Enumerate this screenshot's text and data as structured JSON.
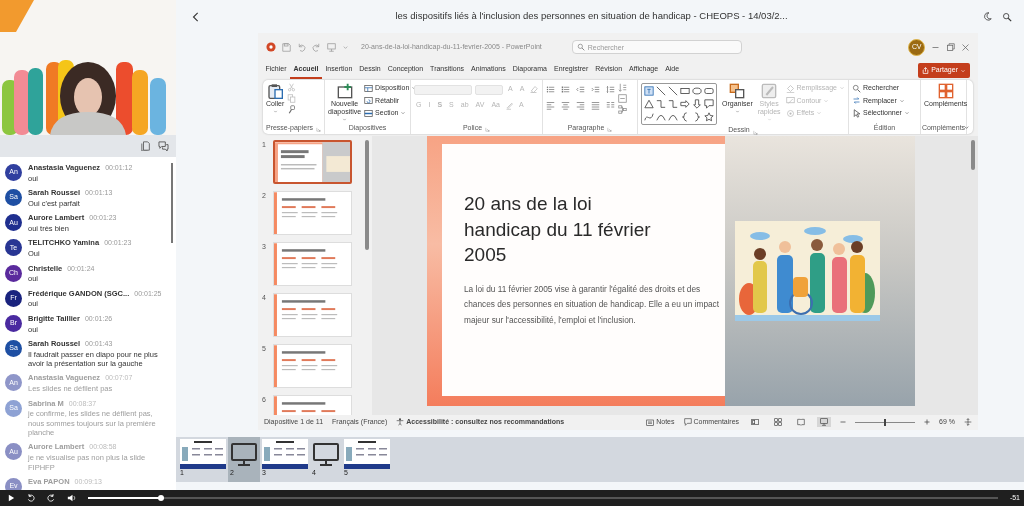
{
  "header": {
    "title": "les dispositifs liés à l'inclusion des personnes en situation de handicap - CHEOPS - 14/03/2..."
  },
  "chat": {
    "messages": [
      {
        "initials": "An",
        "color": "#303f9f",
        "sender": "Anastasia Vaguenez",
        "time": "00:01:12",
        "text": "oui",
        "faded": false
      },
      {
        "initials": "Sa",
        "color": "#1e4fa3",
        "sender": "Sarah Roussel",
        "time": "00:01:13",
        "text": "Oui c'est parfait",
        "faded": false
      },
      {
        "initials": "Au",
        "color": "#1f2f8f",
        "sender": "Aurore Lambert",
        "time": "00:01:23",
        "text": "oui très bien",
        "faded": false
      },
      {
        "initials": "Te",
        "color": "#283593",
        "sender": "TELITCHKO Yamina",
        "time": "00:01:23",
        "text": "Oui",
        "faded": false
      },
      {
        "initials": "Ch",
        "color": "#5a2a9d",
        "sender": "Christelle",
        "time": "00:01:24",
        "text": "oui",
        "faded": false
      },
      {
        "initials": "Fr",
        "color": "#1a237e",
        "sender": "Frédérique GANDON (SGC...",
        "time": "00:01:25",
        "text": "oui",
        "faded": false
      },
      {
        "initials": "Br",
        "color": "#4a2aa0",
        "sender": "Brigitte Taillier",
        "time": "00:01:26",
        "text": "oui",
        "faded": false
      },
      {
        "initials": "Sa",
        "color": "#1e4fa3",
        "sender": "Sarah Roussel",
        "time": "00:01:43",
        "text": "Il faudrait passer en diapo pour ne plus avoir la présentation sur la gauche",
        "faded": false
      },
      {
        "initials": "An",
        "color": "#8f96c9",
        "sender": "Anastasia Vaguenez",
        "time": "00:07:07",
        "text": "Les slides ne défilent pas",
        "faded": true
      },
      {
        "initials": "Sa",
        "color": "#8ea2d4",
        "sender": "Sabrina M",
        "time": "00:08:37",
        "text": "je confirme, les slides ne défilent pas, nous sommes toujours sur la première planche",
        "faded": true
      },
      {
        "initials": "Au",
        "color": "#8a8fc4",
        "sender": "Aurore Lambert",
        "time": "00:08:58",
        "text": "je ne visualise pas non plus la slide FIPHFP",
        "faded": true
      },
      {
        "initials": "Ev",
        "color": "#8a8fc4",
        "sender": "Eva PAPON",
        "time": "00:09:13",
        "faded": true
      }
    ]
  },
  "ppt": {
    "file_title": "20-ans-de-la-loi-handicap-du-11-fevrier-2005 - PowerPoint",
    "search": {
      "placeholder": "Rechercher"
    },
    "user_initials": "CV",
    "tabs": [
      {
        "label": "Fichier",
        "selected": false
      },
      {
        "label": "Accueil",
        "selected": true
      },
      {
        "label": "Insertion",
        "selected": false
      },
      {
        "label": "Dessin",
        "selected": false
      },
      {
        "label": "Conception",
        "selected": false
      },
      {
        "label": "Transitions",
        "selected": false
      },
      {
        "label": "Animations",
        "selected": false
      },
      {
        "label": "Diaporama",
        "selected": false
      },
      {
        "label": "Enregistrer",
        "selected": false
      },
      {
        "label": "Révision",
        "selected": false
      },
      {
        "label": "Affichage",
        "selected": false
      },
      {
        "label": "Aide",
        "selected": false
      }
    ],
    "share_button": "Partager",
    "ribbon": [
      {
        "kind": "clipboard",
        "label": "Presse-papiers",
        "launcher": true,
        "items": [
          {
            "kind": "large",
            "label": "Coller",
            "dropdown": true,
            "disabled": false
          },
          {
            "kind": "icon",
            "disabled": true
          },
          {
            "kind": "icon",
            "disabled": true
          },
          {
            "kind": "icon",
            "disabled": false
          }
        ]
      },
      {
        "kind": "slides",
        "label": "Diapositives",
        "launcher": false,
        "items": [
          {
            "kind": "large",
            "label": "Nouvelle diapositive",
            "dropdown": true,
            "disabled": false
          },
          {
            "kind": "small",
            "label": "Disposition",
            "dropdown": true,
            "disabled": false
          },
          {
            "kind": "small",
            "label": "Rétablir",
            "dropdown": false,
            "disabled": false
          },
          {
            "kind": "small",
            "label": "Section",
            "dropdown": true,
            "disabled": false
          }
        ]
      },
      {
        "kind": "font",
        "label": "Police",
        "launcher": true,
        "first_row": [
          {
            "kind": "field",
            "disabled": true
          },
          {
            "kind": "field",
            "disabled": true
          },
          {
            "kind": "glyph",
            "label": "A",
            "disabled": true
          },
          {
            "kind": "glyph",
            "label": "A",
            "disabled": true
          },
          {
            "kind": "icon",
            "disabled": true
          }
        ],
        "second_row": [
          {
            "kind": "glyph",
            "label": "G",
            "disabled": true
          },
          {
            "kind": "glyph",
            "label": "I",
            "disabled": true
          },
          {
            "kind": "glyph",
            "label": "S",
            "disabled": true
          },
          {
            "kind": "glyph",
            "label": "S",
            "disabled": true
          },
          {
            "kind": "glyph",
            "label": "ab",
            "disabled": true
          },
          {
            "kind": "glyph",
            "label": "AV",
            "disabled": true
          },
          {
            "kind": "glyph",
            "label": "Aa",
            "disabled": true
          },
          {
            "kind": "icon",
            "disabled": true
          },
          {
            "kind": "glyph",
            "label": "A",
            "disabled": true
          }
        ]
      },
      {
        "kind": "paragraph",
        "label": "Paragraphe",
        "launcher": true
      },
      {
        "kind": "drawing",
        "label": "Dessin",
        "launcher": true,
        "items": [
          {
            "kind": "large",
            "label": "Organiser",
            "dropdown": true,
            "disabled": false
          },
          {
            "kind": "large",
            "label": "Styles rapides",
            "dropdown": true,
            "disabled": true
          },
          {
            "kind": "small",
            "label": "Remplissage",
            "dropdown": true,
            "disabled": true
          },
          {
            "kind": "small",
            "label": "Contour",
            "dropdown": true,
            "disabled": true
          },
          {
            "kind": "small",
            "label": "Effets",
            "dropdown": true,
            "disabled": true
          }
        ]
      },
      {
        "kind": "editing",
        "label": "Édition",
        "launcher": false,
        "items": [
          {
            "kind": "small",
            "label": "Rechercher",
            "dropdown": false,
            "disabled": false
          },
          {
            "kind": "small",
            "label": "Remplacer",
            "dropdown": true,
            "disabled": false
          },
          {
            "kind": "small",
            "label": "Sélectionner",
            "dropdown": true,
            "disabled": false
          }
        ]
      },
      {
        "kind": "addins",
        "label": "Compléments",
        "launcher": false,
        "items": [
          {
            "kind": "large",
            "label": "Compléments",
            "dropdown": false,
            "disabled": false
          }
        ]
      }
    ],
    "thumbnails": [
      {
        "number": "1",
        "selected": true
      },
      {
        "number": "2",
        "selected": false
      },
      {
        "number": "3",
        "selected": false
      },
      {
        "number": "4",
        "selected": false
      },
      {
        "number": "5",
        "selected": false
      },
      {
        "number": "6",
        "selected": false
      }
    ],
    "slide": {
      "title": "20 ans de la loi handicap du 11 février 2005",
      "body": "La loi du 11 février 2005 vise à garantir l'égalité des droits et des chances des personnes en situation de handicap. Elle a eu un impact majeur sur l'accessibilité, l'emploi et l'inclusion."
    },
    "status_bar": {
      "slide_position": "Diapositive 1 de 11",
      "language": "Français (France)",
      "accessibility": "Accessibilité : consultez nos recommandations",
      "notes": "Notes",
      "comments": "Commentaires",
      "views": [
        {
          "selected": false
        },
        {
          "selected": false
        },
        {
          "selected": false
        },
        {
          "selected": true
        }
      ],
      "zoom": {
        "level": 0.5,
        "reading": "69 %"
      }
    }
  },
  "filmstrip": [
    {
      "number": "1",
      "kind": "slide",
      "selected": false
    },
    {
      "number": "2",
      "kind": "screen",
      "selected": true
    },
    {
      "number": "3",
      "kind": "slide",
      "selected": false
    },
    {
      "number": "4",
      "kind": "screen",
      "selected": false
    },
    {
      "number": "5",
      "kind": "slide",
      "selected": false
    }
  ],
  "player": {
    "progress": {
      "level": 0.08
    },
    "time": "-51"
  }
}
